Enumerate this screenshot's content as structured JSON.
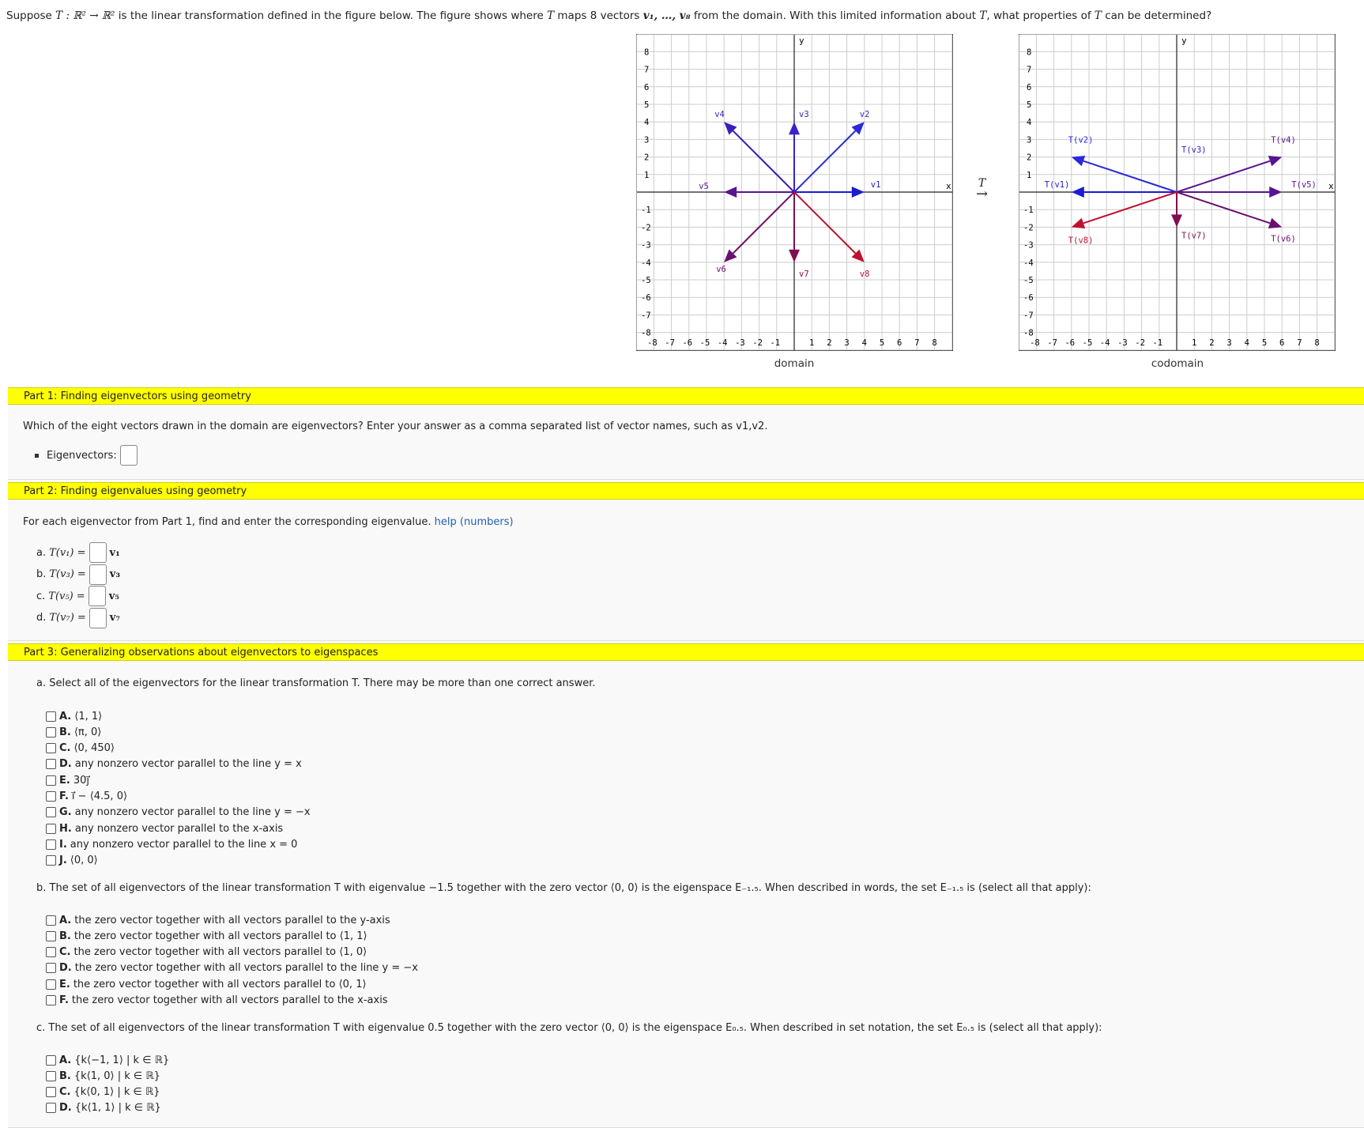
{
  "intro": {
    "p1": "Suppose ",
    "p1m": "T : ℝ² → ℝ²",
    "p2": " is the linear transformation defined in the figure below. The figure shows where ",
    "p2m": "T",
    "p3": " maps 8 vectors ",
    "p3m": "v₁, …, v₈",
    "p4": " from the domain. With this limited information about ",
    "p4m": "T",
    "p5": ", what properties of ",
    "p5m": "T",
    "p6": " can be determined?"
  },
  "domain_graph": {
    "caption": "domain",
    "xaxis_label": "x",
    "yaxis_label": "y",
    "vectors": [
      {
        "name": "v1",
        "x": 4,
        "y": 0,
        "color": "#1b1bd0"
      },
      {
        "name": "v2",
        "x": 4,
        "y": 4,
        "color": "#2a2ad8"
      },
      {
        "name": "v3",
        "x": 0,
        "y": 4,
        "color": "#3a22c8"
      },
      {
        "name": "v4",
        "x": -4,
        "y": 4,
        "color": "#3b1fb8"
      },
      {
        "name": "v5",
        "x": -4,
        "y": 0,
        "color": "#5a1490"
      },
      {
        "name": "v6",
        "x": -4,
        "y": -4,
        "color": "#6a1070"
      },
      {
        "name": "v7",
        "x": 0,
        "y": -4,
        "color": "#801050"
      },
      {
        "name": "v8",
        "x": 4,
        "y": -4,
        "color": "#c01030"
      }
    ]
  },
  "codomain_graph": {
    "caption": "codomain",
    "xaxis_label": "x",
    "yaxis_label": "y",
    "vectors": [
      {
        "name": "T(v1)",
        "x": -6,
        "y": 0,
        "color": "#1b1bd0"
      },
      {
        "name": "T(v2)",
        "x": -6,
        "y": 2,
        "color": "#2a2ad8"
      },
      {
        "name": "T(v3)",
        "x": 0,
        "y": 0,
        "color": "#3a22c8"
      },
      {
        "name": "T(v4)",
        "x": 6,
        "y": 2,
        "color": "#5a1490"
      },
      {
        "name": "T(v5)",
        "x": 6,
        "y": 0,
        "color": "#5a1490"
      },
      {
        "name": "T(v6)",
        "x": 6,
        "y": -2,
        "color": "#6a1070"
      },
      {
        "name": "T(v7)",
        "x": 0,
        "y": -2,
        "color": "#801050"
      },
      {
        "name": "T(v8)",
        "x": -6,
        "y": -2,
        "color": "#c01030"
      }
    ]
  },
  "arrow_label": "T",
  "arrow_glyph": "→",
  "part1": {
    "title": "Part 1: Finding eigenvectors using geometry",
    "question": "Which of the eight vectors drawn in the domain are eigenvectors? Enter your answer as a comma separated list of vector names, such as v1,v2.",
    "label": "Eigenvectors:"
  },
  "part2": {
    "title": "Part 2: Finding eigenvalues using geometry",
    "question": "For each eigenvector from Part 1, find and enter the corresponding eigenvalue.",
    "help": "help (numbers)",
    "rows": [
      {
        "prefix": "a.",
        "lhs": "T(v₁) =",
        "rhs": "v₁"
      },
      {
        "prefix": "b.",
        "lhs": "T(v₃) =",
        "rhs": "v₃"
      },
      {
        "prefix": "c.",
        "lhs": "T(v₅) =",
        "rhs": "v₅"
      },
      {
        "prefix": "d.",
        "lhs": "T(v₇) =",
        "rhs": "v₇"
      }
    ]
  },
  "part3": {
    "title": "Part 3: Generalizing observations about eigenvectors to eigenspaces",
    "qa": "a. Select all of the eigenvectors for the linear transformation T. There may be more than one correct answer.",
    "qa_opts": [
      {
        "k": "A.",
        "t": "⟨1, 1⟩"
      },
      {
        "k": "B.",
        "t": "⟨π, 0⟩"
      },
      {
        "k": "C.",
        "t": "⟨0, 450⟩"
      },
      {
        "k": "D.",
        "t": "any nonzero vector parallel to the line y = x"
      },
      {
        "k": "E.",
        "t": "30j⃗"
      },
      {
        "k": "F.",
        "t": "i⃗ − ⟨4.5, 0⟩"
      },
      {
        "k": "G.",
        "t": "any nonzero vector parallel to the line y = −x"
      },
      {
        "k": "H.",
        "t": "any nonzero vector parallel to the x-axis"
      },
      {
        "k": "I.",
        "t": "any nonzero vector parallel to the line x = 0"
      },
      {
        "k": "J.",
        "t": "⟨0, 0⟩"
      }
    ],
    "qb": "b. The set of all eigenvectors of the linear transformation T with eigenvalue −1.5 together with the zero vector ⟨0, 0⟩ is the eigenspace E₋₁.₅. When described in words, the set E₋₁.₅ is (select all that apply):",
    "qb_opts": [
      {
        "k": "A.",
        "t": "the zero vector together with all vectors parallel to the y-axis"
      },
      {
        "k": "B.",
        "t": "the zero vector together with all vectors parallel to ⟨1, 1⟩"
      },
      {
        "k": "C.",
        "t": "the zero vector together with all vectors parallel to ⟨1, 0⟩"
      },
      {
        "k": "D.",
        "t": "the zero vector together with all vectors parallel to the line y = −x"
      },
      {
        "k": "E.",
        "t": "the zero vector together with all vectors parallel to ⟨0, 1⟩"
      },
      {
        "k": "F.",
        "t": "the zero vector together with all vectors parallel to the x-axis"
      }
    ],
    "qc": "c. The set of all eigenvectors of the linear transformation T with eigenvalue 0.5 together with the zero vector ⟨0, 0⟩ is the eigenspace E₀.₅. When described in set notation, the set E₀.₅ is (select all that apply):",
    "qc_opts": [
      {
        "k": "A.",
        "t": "{k⟨−1, 1⟩ | k ∈ ℝ}"
      },
      {
        "k": "B.",
        "t": "{k⟨1, 0⟩ | k ∈ ℝ}"
      },
      {
        "k": "C.",
        "t": "{k⟨0, 1⟩ | k ∈ ℝ}"
      },
      {
        "k": "D.",
        "t": "{k⟨1, 1⟩ | k ∈ ℝ}"
      }
    ]
  }
}
